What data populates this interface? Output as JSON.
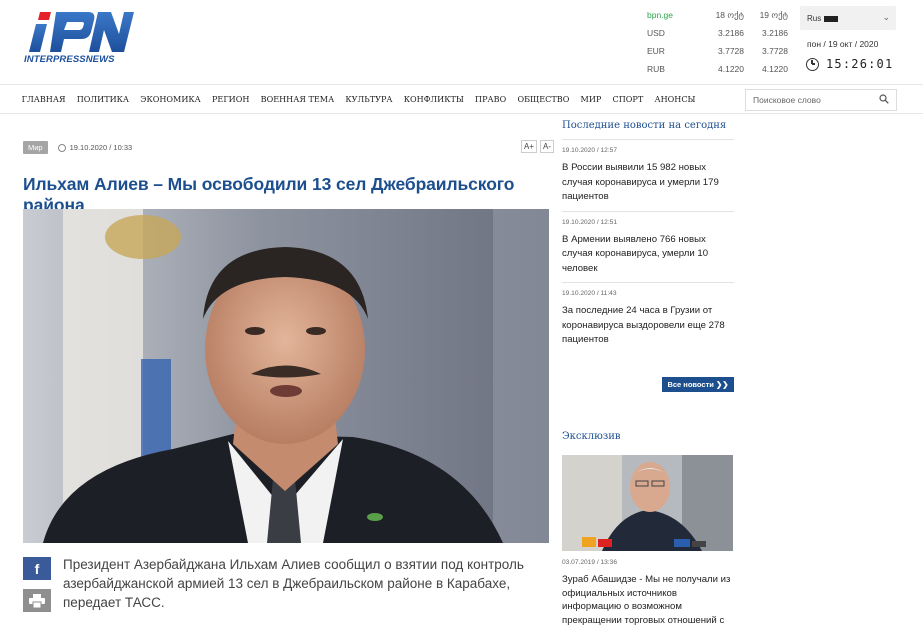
{
  "brand": {
    "logo_mark": "IPN",
    "logo_text": "INTERPRESSNEWS"
  },
  "rates": {
    "source": "bpn.ge",
    "col1": "18 ოქტ",
    "col2": "19 ოქტ",
    "rows": [
      {
        "cur": "USD",
        "v1": "3.2186",
        "v2": "3.2186"
      },
      {
        "cur": "EUR",
        "v1": "3.7728",
        "v2": "3.7728"
      },
      {
        "cur": "RUB",
        "v1": "4.1220",
        "v2": "4.1220"
      }
    ]
  },
  "lang": {
    "selected": "Rus"
  },
  "date_text": "пон / 19 окт / 2020",
  "clock_text": "15:26:01",
  "nav": {
    "items": [
      "ГЛАВНАЯ",
      "ПОЛИТИКА",
      "ЭКОНОМИКА",
      "РЕГИОН",
      "ВОЕННАЯ ТЕМА",
      "КУЛЬТУРА",
      "КОНФЛИКТЫ",
      "ПРАВО",
      "ОБЩЕСТВО",
      "МИР",
      "СПОРТ",
      "АНОНСЫ"
    ],
    "search_placeholder": "Поисковое слово"
  },
  "article": {
    "category": "Мир",
    "datetime": "19.10.2020 / 10:33",
    "font_tools": [
      "A+",
      "A-"
    ],
    "title": "Ильхам Алиев – Мы освободили 13 сел Джебраильского района",
    "lead": "Президент Азербайджана Ильхам Алиев сообщил о взятии под контроль азербайджанской армией 13 сел в Джебраильском районе в Карабахе, передает ТАСС."
  },
  "sidebar": {
    "latest_title": "Последние новости на сегодня",
    "news": [
      {
        "date": "19.10.2020 / 12:57",
        "text": "В России выявили 15 982 новых случая коронавируса и умерли 179 пациентов"
      },
      {
        "date": "19.10.2020 / 12:51",
        "text": "В Армении выявлено 766 новых случая коронавируса, умерли 10 человек"
      },
      {
        "date": "19.10.2020 / 11:43",
        "text": "За последние 24 часа в Грузии от коронавируса выздоровели еще 278 пациентов"
      }
    ],
    "all_news_label": "Все новости ❯❯",
    "exclusive_title": "Эксклюзив",
    "exclusive": {
      "date": "03.07.2019 / 13:36",
      "text": "Зураб Абашидзе - Мы не получали из официальных источников информацию о возможном прекращении торговых отношений с"
    }
  },
  "colors": {
    "brand_blue": "#1d4f8f",
    "facebook": "#3b5a9a",
    "rates_green": "#2aa74a"
  }
}
